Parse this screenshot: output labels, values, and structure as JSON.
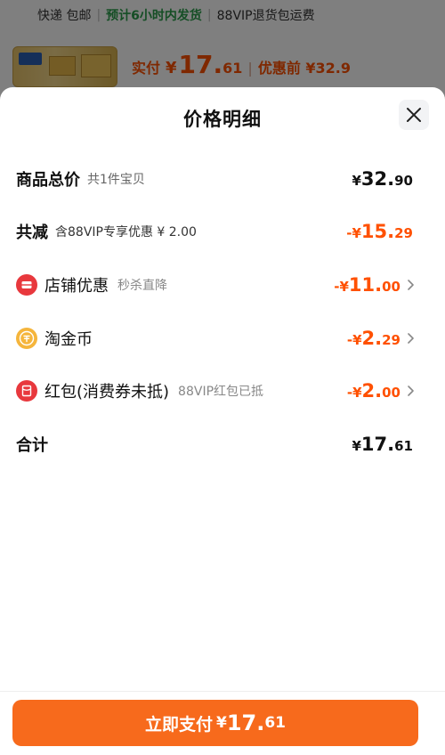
{
  "background": {
    "shipping": "快递 包邮",
    "eta": "预计6小时内发货",
    "return_note": "88VIP退货包运费",
    "pay_label": "实付",
    "pay_yen": "¥",
    "pay_int": "17.",
    "pay_dec": "61",
    "divider": "|",
    "before_discount": "优惠前 ¥32.9"
  },
  "sheet": {
    "title": "价格明细",
    "rows": [
      {
        "label": "商品总价",
        "sub": "共1件宝贝",
        "yen": "¥",
        "int": "32.",
        "dec": "90"
      },
      {
        "label": "共减",
        "sub": "含88VIP专享优惠 ¥ 2.00",
        "yen": "-¥",
        "int": "15.",
        "dec": "29"
      },
      {
        "label": "店铺优惠",
        "sub": "秒杀直降",
        "yen": "-¥",
        "int": "11.",
        "dec": "00"
      },
      {
        "label": "淘金币",
        "sub": "",
        "yen": "-¥",
        "int": "2.",
        "dec": "29"
      },
      {
        "label": "红包(消费券未抵)",
        "sub": "88VIP红包已抵",
        "yen": "-¥",
        "int": "2.",
        "dec": "00"
      },
      {
        "label": "合计",
        "sub": "",
        "yen": "¥",
        "int": "17.",
        "dec": "61"
      }
    ]
  },
  "pay_button": {
    "label": "立即支付",
    "yen": "¥",
    "int": "17.",
    "dec": "61"
  },
  "colors": {
    "accent": "#ff5000",
    "button": "#f76a1c"
  }
}
